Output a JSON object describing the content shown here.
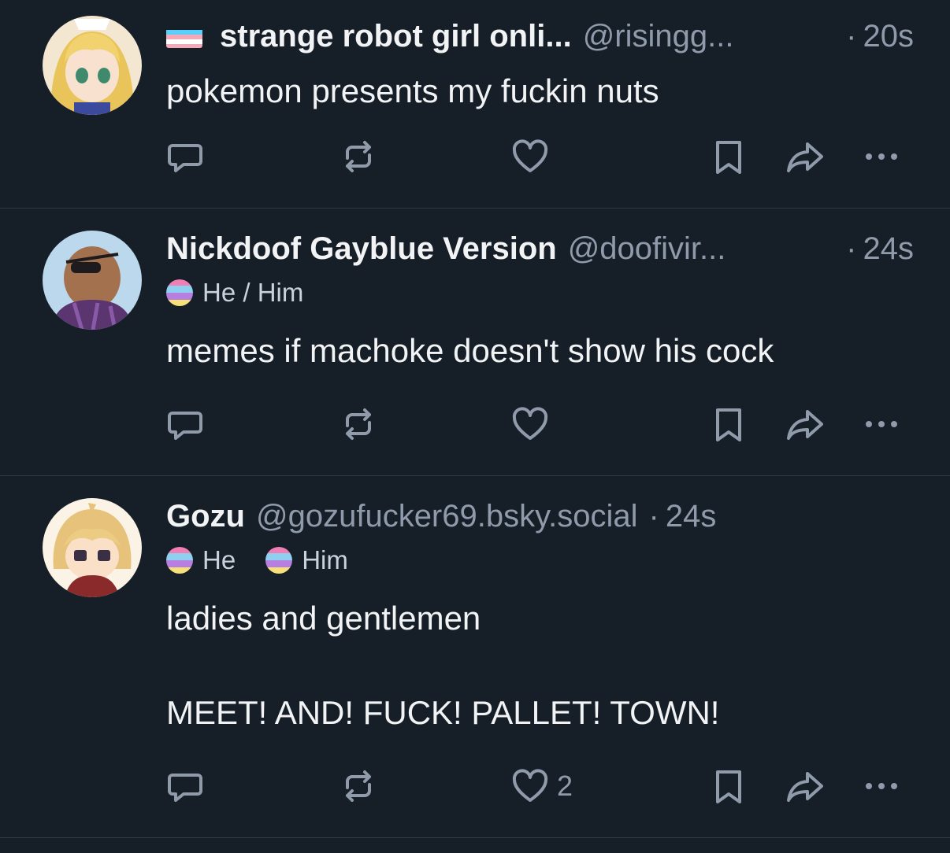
{
  "posts": [
    {
      "display_name": "strange robot girl onli...",
      "handle": "@risingg...",
      "separator": "·",
      "time": "20s",
      "has_flag": true,
      "pronouns": [],
      "text": "pokemon presents my fuckin nuts",
      "like_count": ""
    },
    {
      "display_name": "Nickdoof Gayblue Version",
      "handle": "@doofivir...",
      "separator": "·",
      "time": "24s",
      "has_flag": false,
      "pronouns": [
        "He / Him"
      ],
      "text": "memes if machoke doesn't show his cock",
      "like_count": ""
    },
    {
      "display_name": "Gozu",
      "handle": "@gozufucker69.bsky.social",
      "separator": "·",
      "time": "24s",
      "has_flag": false,
      "pronouns": [
        "He",
        "Him"
      ],
      "text": "ladies and gentlemen\n\nMEET! AND! FUCK! PALLET! TOWN!",
      "like_count": "2"
    }
  ],
  "icons": {
    "reply": "reply-icon",
    "repost": "repost-icon",
    "like": "heart-icon",
    "bookmark": "bookmark-icon",
    "share": "share-icon",
    "more": "more-icon"
  },
  "colors": {
    "background": "#161e27",
    "muted": "#8f9bab",
    "divider": "#2e3a48"
  }
}
